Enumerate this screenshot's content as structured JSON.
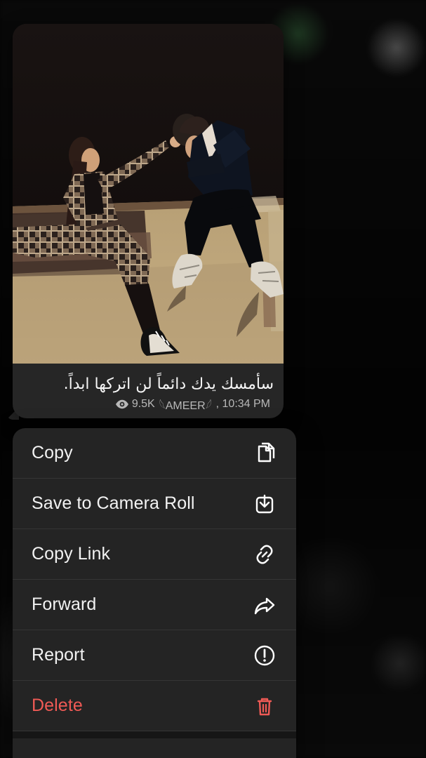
{
  "message": {
    "caption": "سأمسك يدك دائماً لن اتركها ابداً.",
    "views": "9.5K",
    "author": "𓆩AMEER𓆪",
    "time": ", 10:34 PM",
    "image_description": "photo of a couple sitting on a ledge at night",
    "icons": {
      "views": "eye-icon"
    }
  },
  "menu": {
    "items": [
      {
        "label": "Copy",
        "icon": "copy-icon"
      },
      {
        "label": "Save to Camera Roll",
        "icon": "save-icon"
      },
      {
        "label": "Copy Link",
        "icon": "link-icon"
      },
      {
        "label": "Forward",
        "icon": "forward-icon"
      },
      {
        "label": "Report",
        "icon": "report-icon"
      },
      {
        "label": "Delete",
        "icon": "trash-icon"
      }
    ],
    "partially_visible_icon": "more-icon"
  },
  "colors": {
    "background": "#050505",
    "message_bubble": "#262626",
    "menu_background": "#252525",
    "text_primary": "#f2f2f2",
    "text_secondary": "#b8b8b8",
    "delete": "#ef5a55"
  }
}
